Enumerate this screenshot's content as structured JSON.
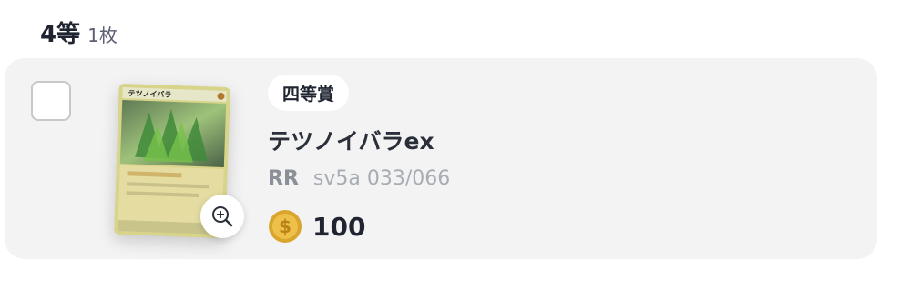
{
  "header": {
    "rank": "4等",
    "count": "1枚"
  },
  "item": {
    "badge": "四等賞",
    "name": "テツノイバラex",
    "rarity": "RR",
    "set_code": "sv5a 033/066",
    "price": "100",
    "card_title_on_image": "テツノイバラ",
    "checkbox_checked": false
  },
  "icons": {
    "zoom": "zoom-in-icon",
    "coin": "coin-icon"
  },
  "colors": {
    "row_bg": "#f3f3f3",
    "coin": "#e0b033",
    "text": "#1f2430"
  }
}
